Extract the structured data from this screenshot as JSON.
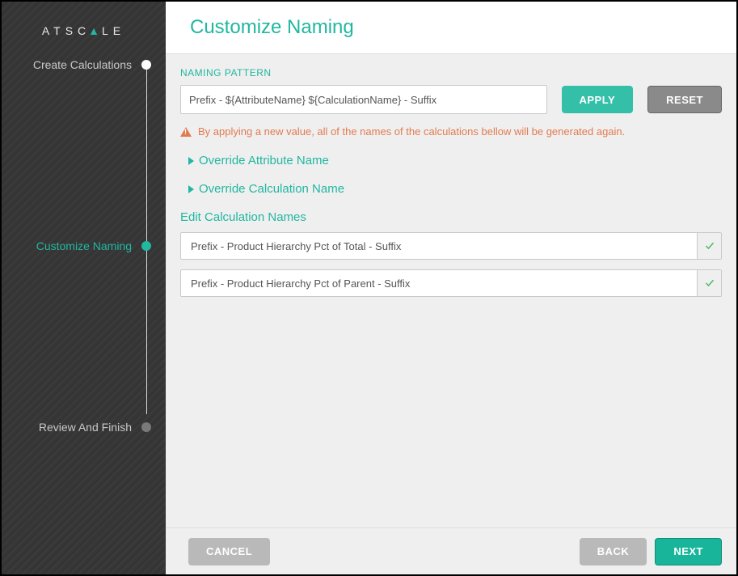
{
  "brand": {
    "part1": "ATSC",
    "triangle": "▲",
    "part2": "LE"
  },
  "header": {
    "title": "Customize Naming"
  },
  "sidebar": {
    "steps": [
      {
        "label": "Create Calculations",
        "state": "done"
      },
      {
        "label": "Customize Naming",
        "state": "active"
      },
      {
        "label": "Review And Finish",
        "state": "future"
      }
    ]
  },
  "naming": {
    "section_label": "NAMING PATTERN",
    "pattern_value": "Prefix - ${AttributeName} ${CalculationName} - Suffix",
    "apply_label": "APPLY",
    "reset_label": "RESET"
  },
  "warning": {
    "text": "By applying a new value, all of the names of the calculations bellow will be generated again."
  },
  "overrides": {
    "attr_label": "Override Attribute Name",
    "calc_label": "Override Calculation Name"
  },
  "edit": {
    "title": "Edit Calculation Names",
    "rows": [
      {
        "value": "Prefix - Product Hierarchy Pct of Total - Suffix"
      },
      {
        "value": "Prefix - Product Hierarchy Pct of Parent - Suffix"
      }
    ]
  },
  "footer": {
    "cancel": "CANCEL",
    "back": "BACK",
    "next": "NEXT"
  },
  "colors": {
    "teal": "#21b7a1",
    "warn": "#e37a4f"
  }
}
